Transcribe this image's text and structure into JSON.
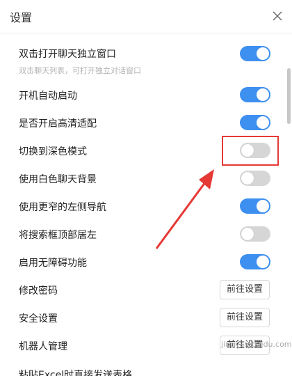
{
  "header": {
    "title": "设置",
    "close_icon": "close-icon"
  },
  "settings": [
    {
      "label": "双击打开聊天独立窗口",
      "sub": "双击聊天列表，可打开独立对话窗口",
      "type": "toggle",
      "on": true
    },
    {
      "label": "开机自动启动",
      "type": "toggle",
      "on": true
    },
    {
      "label": "是否开启高清适配",
      "type": "toggle",
      "on": true
    },
    {
      "label": "切换到深色模式",
      "type": "toggle",
      "on": false
    },
    {
      "label": "使用白色聊天背景",
      "type": "toggle",
      "on": false
    },
    {
      "label": "使用更窄的左侧导航",
      "type": "toggle",
      "on": true
    },
    {
      "label": "将搜索框顶部居左",
      "type": "toggle",
      "on": false
    },
    {
      "label": "启用无障碍功能",
      "type": "toggle",
      "on": true
    },
    {
      "label": "修改密码",
      "type": "button",
      "button_label": "前往设置"
    },
    {
      "label": "安全设置",
      "type": "button",
      "button_label": "前往设置"
    },
    {
      "label": "机器人管理",
      "type": "button",
      "button_label": "前往设置"
    }
  ],
  "partial_row": "粘贴Excel时直接发送表格",
  "watermark": "jingyan.baidu.com",
  "colors": {
    "toggle_on": "#3d8ff0",
    "toggle_off": "#d6d6d6",
    "annotation": "#e53935"
  }
}
